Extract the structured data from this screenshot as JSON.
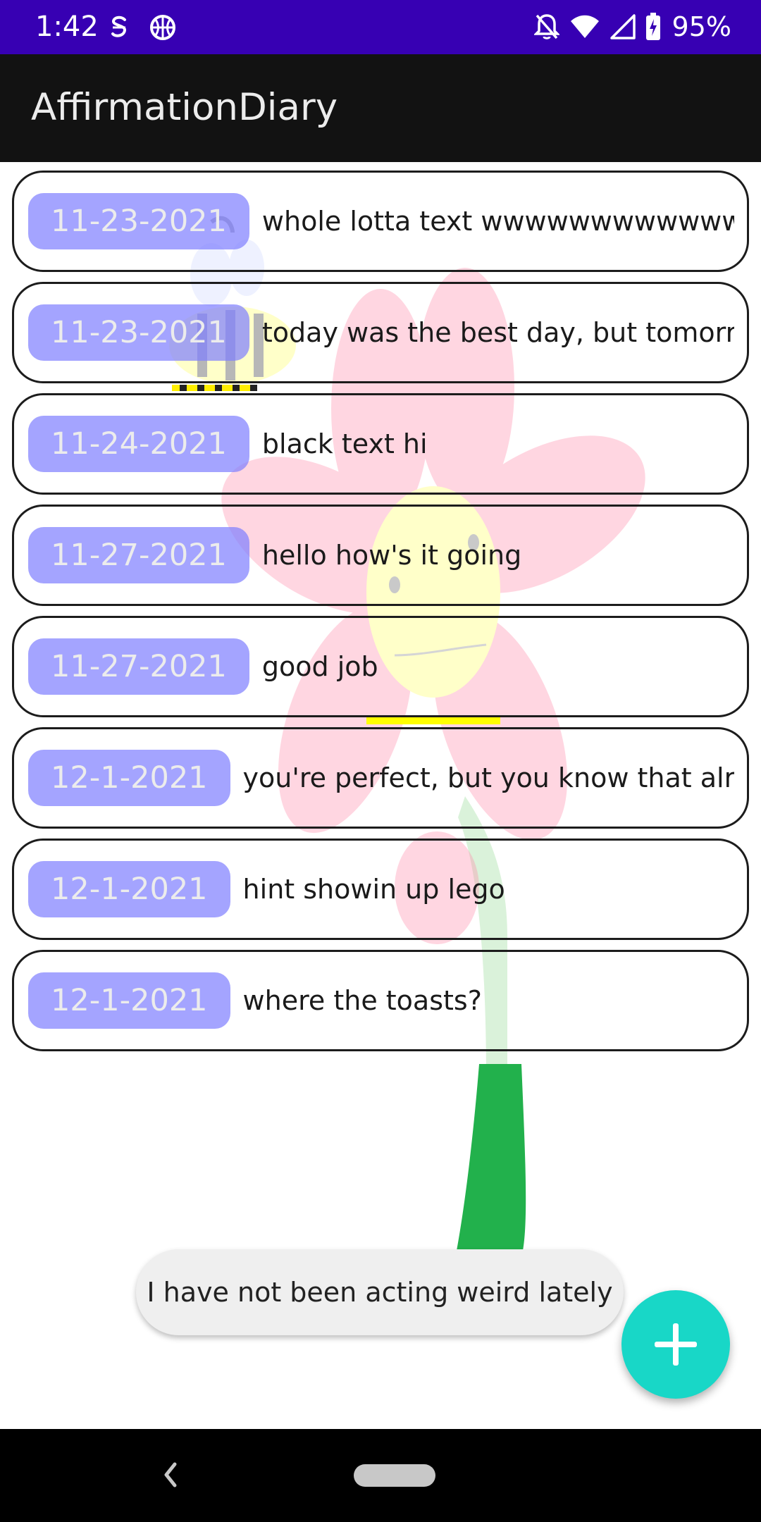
{
  "status_bar": {
    "time": "1:42",
    "battery": "95%",
    "left_icons": [
      "notification-app-icon",
      "basketball-icon"
    ],
    "right_icons": [
      "notifications-off-icon",
      "wifi-icon",
      "cell-signal-icon",
      "battery-charging-icon"
    ],
    "color": "#3700B3"
  },
  "app_bar": {
    "title": "AffirmationDiary"
  },
  "entries": [
    {
      "date": "11-23-2021",
      "text": "whole lotta text wwwwwwwwwwwwwwwwwwwwww"
    },
    {
      "date": "11-23-2021",
      "text": "today was the best day, but tomorrow is"
    },
    {
      "date": "11-24-2021",
      "text": "black text hi"
    },
    {
      "date": "11-27-2021",
      "text": "hello how's it going"
    },
    {
      "date": "11-27-2021",
      "text": "good job"
    },
    {
      "date": "12-1-2021",
      "text": "you're perfect, but you know that already"
    },
    {
      "date": "12-1-2021",
      "text": "hint showin up lego"
    },
    {
      "date": "12-1-2021",
      "text": "where the toasts?"
    }
  ],
  "toast": {
    "text": "I have not been acting weird lately"
  },
  "fab": {
    "icon": "plus-icon",
    "color": "#18D7C7"
  },
  "colors": {
    "date_chip": "#7D7DFF",
    "app_bar": "#121212"
  }
}
